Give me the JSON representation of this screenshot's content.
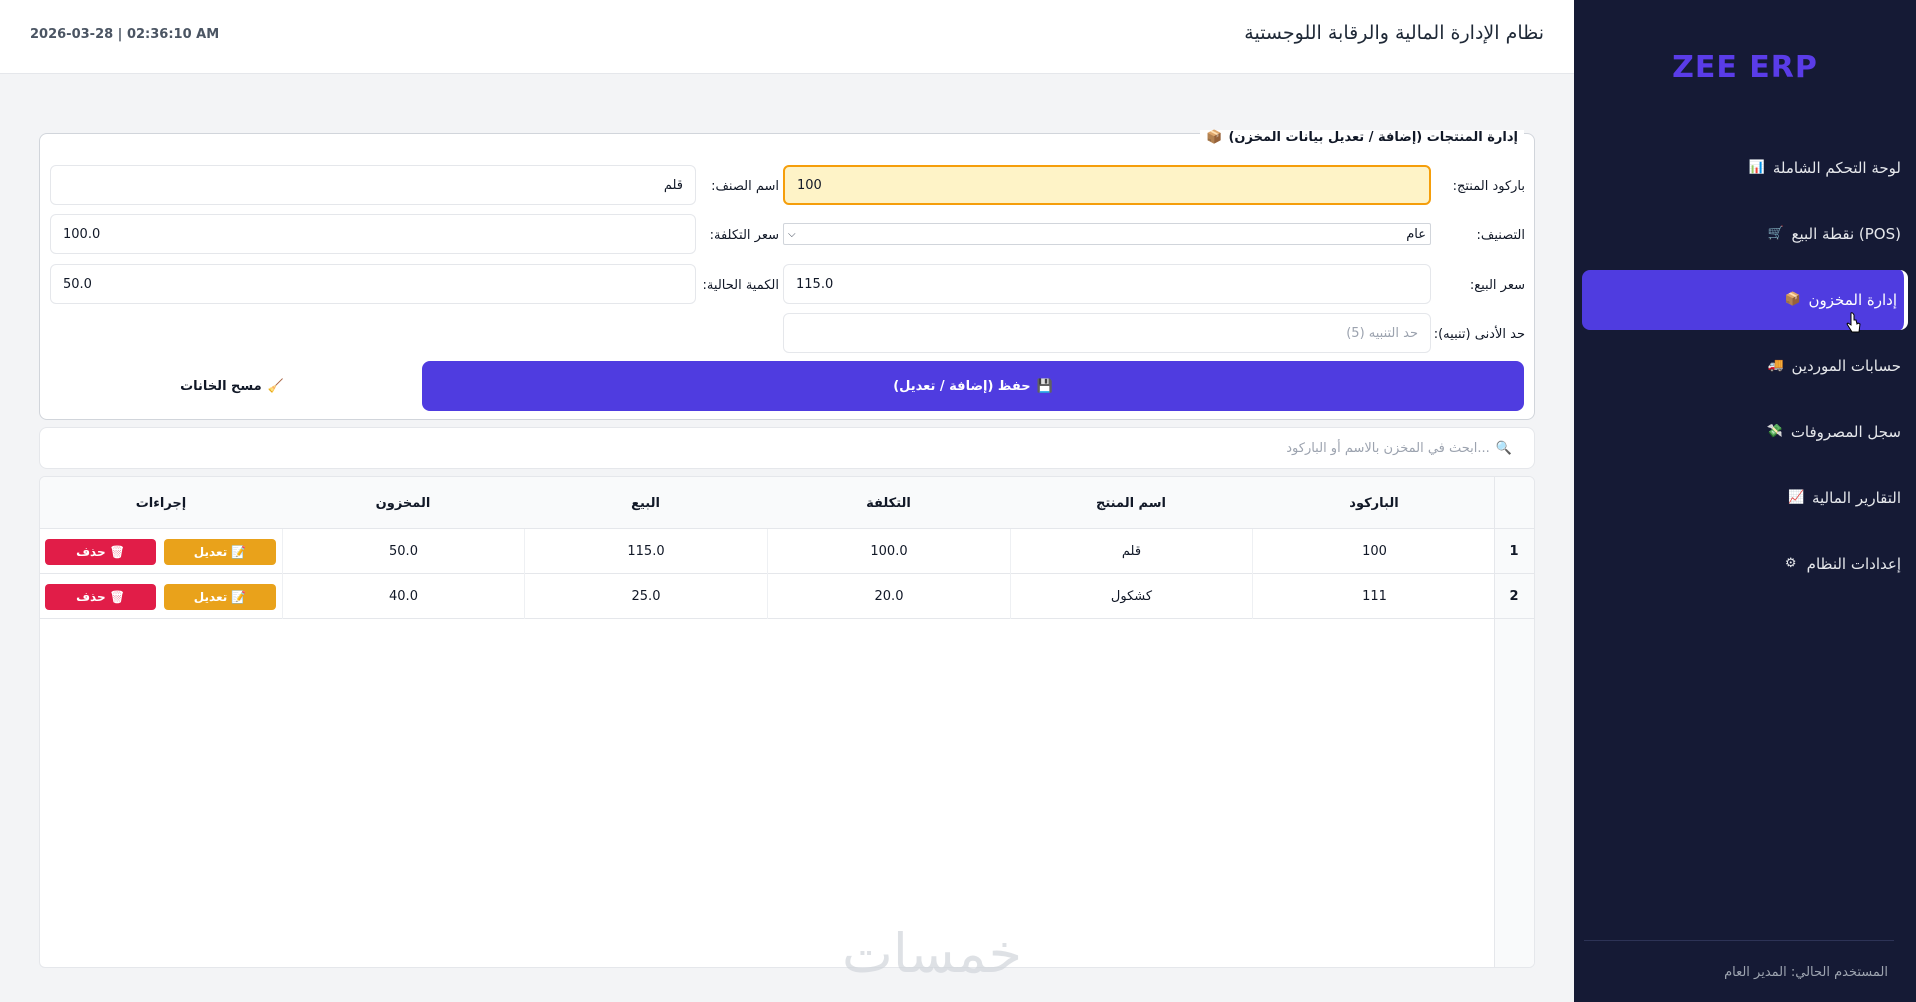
{
  "sidebar": {
    "brand": "ZEE ERP",
    "items": [
      {
        "label": "لوحة التحكم الشاملة",
        "icon": "chart-icon",
        "glyph": "📊"
      },
      {
        "label": "نقطة البيع (POS)",
        "icon": "cart-icon",
        "glyph": "🛒"
      },
      {
        "label": "إدارة المخزون",
        "icon": "box-icon",
        "glyph": "📦",
        "active": true
      },
      {
        "label": "حسابات الموردين",
        "icon": "truck-icon",
        "glyph": "🚚"
      },
      {
        "label": "سجل المصروفات",
        "icon": "money-icon",
        "glyph": "💸"
      },
      {
        "label": "التقارير المالية",
        "icon": "report-icon",
        "glyph": "📈"
      },
      {
        "label": "إعدادات النظام",
        "icon": "gear-icon",
        "glyph": "⚙"
      }
    ],
    "user": "المستخدم الحالي: المدير العام"
  },
  "topbar": {
    "title": "نظام الإدارة المالية والرقابة اللوجستية",
    "datetime": "2026-03-28 | 02:36:10 AM"
  },
  "form": {
    "legend": "إدارة المنتجات (إضافة / تعديل بيانات المخزن)",
    "barcode_label": "باركود المنتج:",
    "barcode_value": "100",
    "name_label": "اسم الصنف:",
    "name_value": "قلم",
    "category_label": "التصنيف:",
    "category_value": "عام",
    "cost_label": "سعر التكلفة:",
    "cost_value": "100.0",
    "sale_label": "سعر البيع:",
    "sale_value": "115.0",
    "qty_label": "الكمية الحالية:",
    "qty_value": "50.0",
    "min_label": "حد الأدنى (تنبيه):",
    "min_placeholder": "حد التنبيه (5)",
    "save_label": "حفظ (إضافة / تعديل)",
    "clear_label": "مسح الخانات"
  },
  "search": {
    "placeholder": "ابحث في المخزن بالاسم أو الباركود..."
  },
  "table": {
    "headers": {
      "barcode": "الباركود",
      "name": "اسم المنتج",
      "cost": "التكلفة",
      "sale": "البيع",
      "stock": "المخزون",
      "actions": "إجراءات"
    },
    "edit_label": "تعديل",
    "delete_label": "حذف",
    "rows": [
      {
        "num": "1",
        "barcode": "100",
        "name": "قلم",
        "cost": "100.0",
        "sale": "115.0",
        "stock": "50.0"
      },
      {
        "num": "2",
        "barcode": "111",
        "name": "كشكول",
        "cost": "20.0",
        "sale": "25.0",
        "stock": "40.0"
      }
    ]
  },
  "watermark": "خمسات",
  "colors": {
    "sidebar_bg": "#151a35",
    "accent": "#4f3ce0",
    "edit": "#e9a21b",
    "delete": "#e11d48"
  }
}
